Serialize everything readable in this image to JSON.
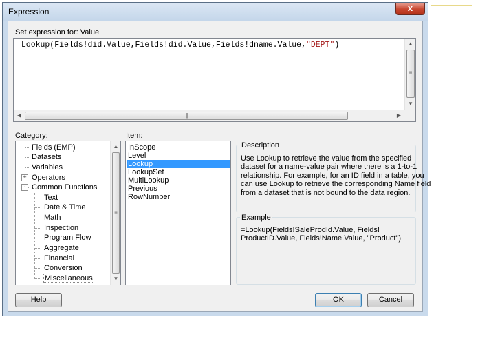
{
  "window": {
    "title": "Expression",
    "close_glyph": "x"
  },
  "expression": {
    "label": "Set expression for: Value",
    "text_prefix": "=Lookup(Fields!did.Value,Fields!did.Value,Fields!dname.Value,",
    "text_string": "\"DEPT\"",
    "text_suffix": ")"
  },
  "category": {
    "label": "Category:",
    "items": [
      {
        "label": "Fields (EMP)"
      },
      {
        "label": "Datasets"
      },
      {
        "label": "Variables"
      },
      {
        "label": "Operators",
        "expander": "+"
      },
      {
        "label": "Common Functions",
        "expander": "-"
      },
      {
        "label": "Text"
      },
      {
        "label": "Date & Time"
      },
      {
        "label": "Math"
      },
      {
        "label": "Inspection"
      },
      {
        "label": "Program Flow"
      },
      {
        "label": "Aggregate"
      },
      {
        "label": "Financial"
      },
      {
        "label": "Conversion"
      },
      {
        "label": "Miscellaneous"
      }
    ]
  },
  "item_list": {
    "label": "Item:",
    "items": [
      "InScope",
      "Level",
      "Lookup",
      "LookupSet",
      "MultiLookup",
      "Previous",
      "RowNumber"
    ],
    "selected": "Lookup"
  },
  "description": {
    "title": "Description",
    "lines": [
      "Use Lookup to retrieve the value from the specified",
      "dataset for a name-value pair where there is a 1-to-1",
      "relationship. For example, for an ID field in a table, you",
      "can use Lookup to retrieve the corresponding Name field",
      "from a dataset that is not bound to the data region."
    ]
  },
  "example": {
    "title": "Example",
    "lines": [
      "=Lookup(Fields!SaleProdId.Value, Fields!",
      "ProductID.Value,  Fields!Name.Value, \"Product\")"
    ]
  },
  "buttons": {
    "help": "Help",
    "ok": "OK",
    "cancel": "Cancel"
  },
  "icons": {
    "scroll_up": "up-arrow-icon",
    "scroll_down": "down-arrow-icon",
    "scroll_left": "left-arrow-icon",
    "scroll_right": "right-arrow-icon"
  },
  "colors": {
    "string_literal": "#a31515",
    "selection": "#3399ff",
    "close_button": "#c7462f"
  }
}
